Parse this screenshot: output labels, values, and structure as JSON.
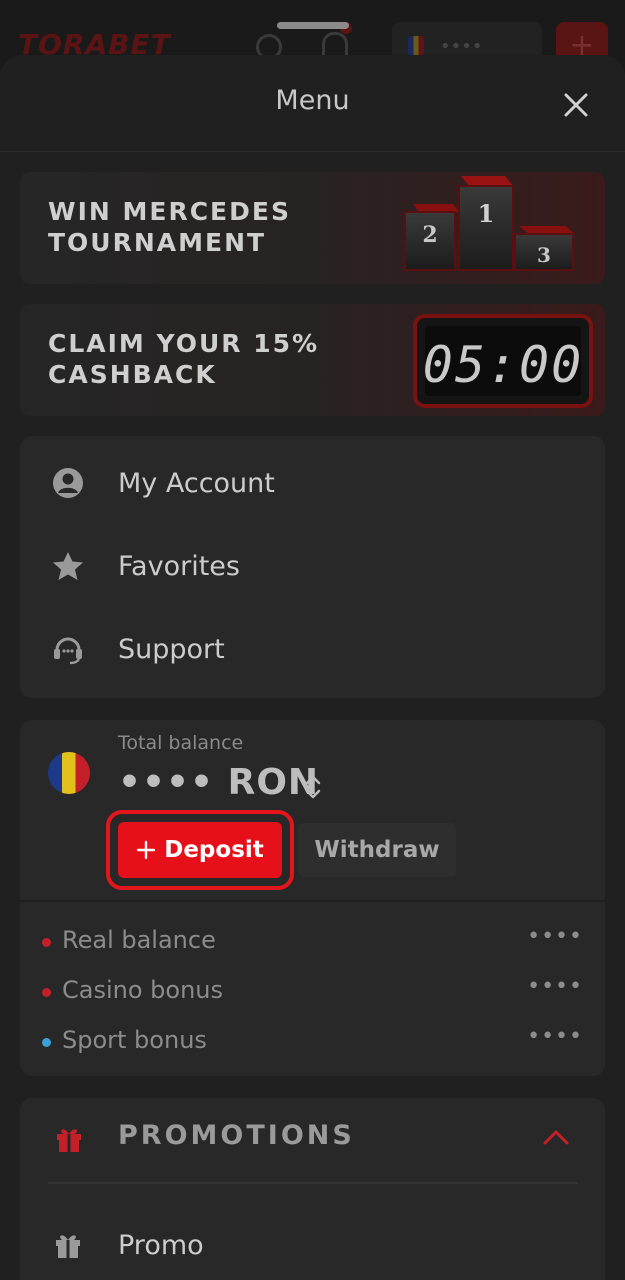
{
  "background_header": {
    "logo": "TORABET",
    "balance_masked": "••••"
  },
  "menu": {
    "title": "Menu"
  },
  "banners": [
    {
      "line1": "WIN MERCEDES",
      "line2": "TOURNAMENT",
      "art": "podium",
      "podium_labels": [
        "2",
        "1",
        "3"
      ]
    },
    {
      "line1": "CLAIM YOUR 15%",
      "line2": "CASHBACK",
      "art": "timer",
      "timer_text": "05:00"
    }
  ],
  "account_menu": {
    "items": [
      {
        "label": "My Account",
        "icon": "user-circle-icon"
      },
      {
        "label": "Favorites",
        "icon": "star-icon"
      },
      {
        "label": "Support",
        "icon": "headset-icon"
      }
    ]
  },
  "balance": {
    "label": "Total balance",
    "masked": "••••",
    "currency": "RON",
    "value": "•••• RON",
    "deposit_label": "Deposit",
    "withdraw_label": "Withdraw",
    "sub_balances": [
      {
        "label": "Real balance",
        "value": "••••",
        "dot_color": "#c4202a"
      },
      {
        "label": "Casino bonus",
        "value": "••••",
        "dot_color": "#c4202a"
      },
      {
        "label": "Sport bonus",
        "value": "••••",
        "dot_color": "#3aa0d6"
      }
    ]
  },
  "promotions": {
    "title": "PROMOTIONS",
    "items": [
      {
        "label": "Promo",
        "icon": "gift-icon"
      }
    ]
  },
  "colors": {
    "accent": "#e5101a",
    "sheet_bg": "#202020",
    "card_bg": "#282828"
  }
}
